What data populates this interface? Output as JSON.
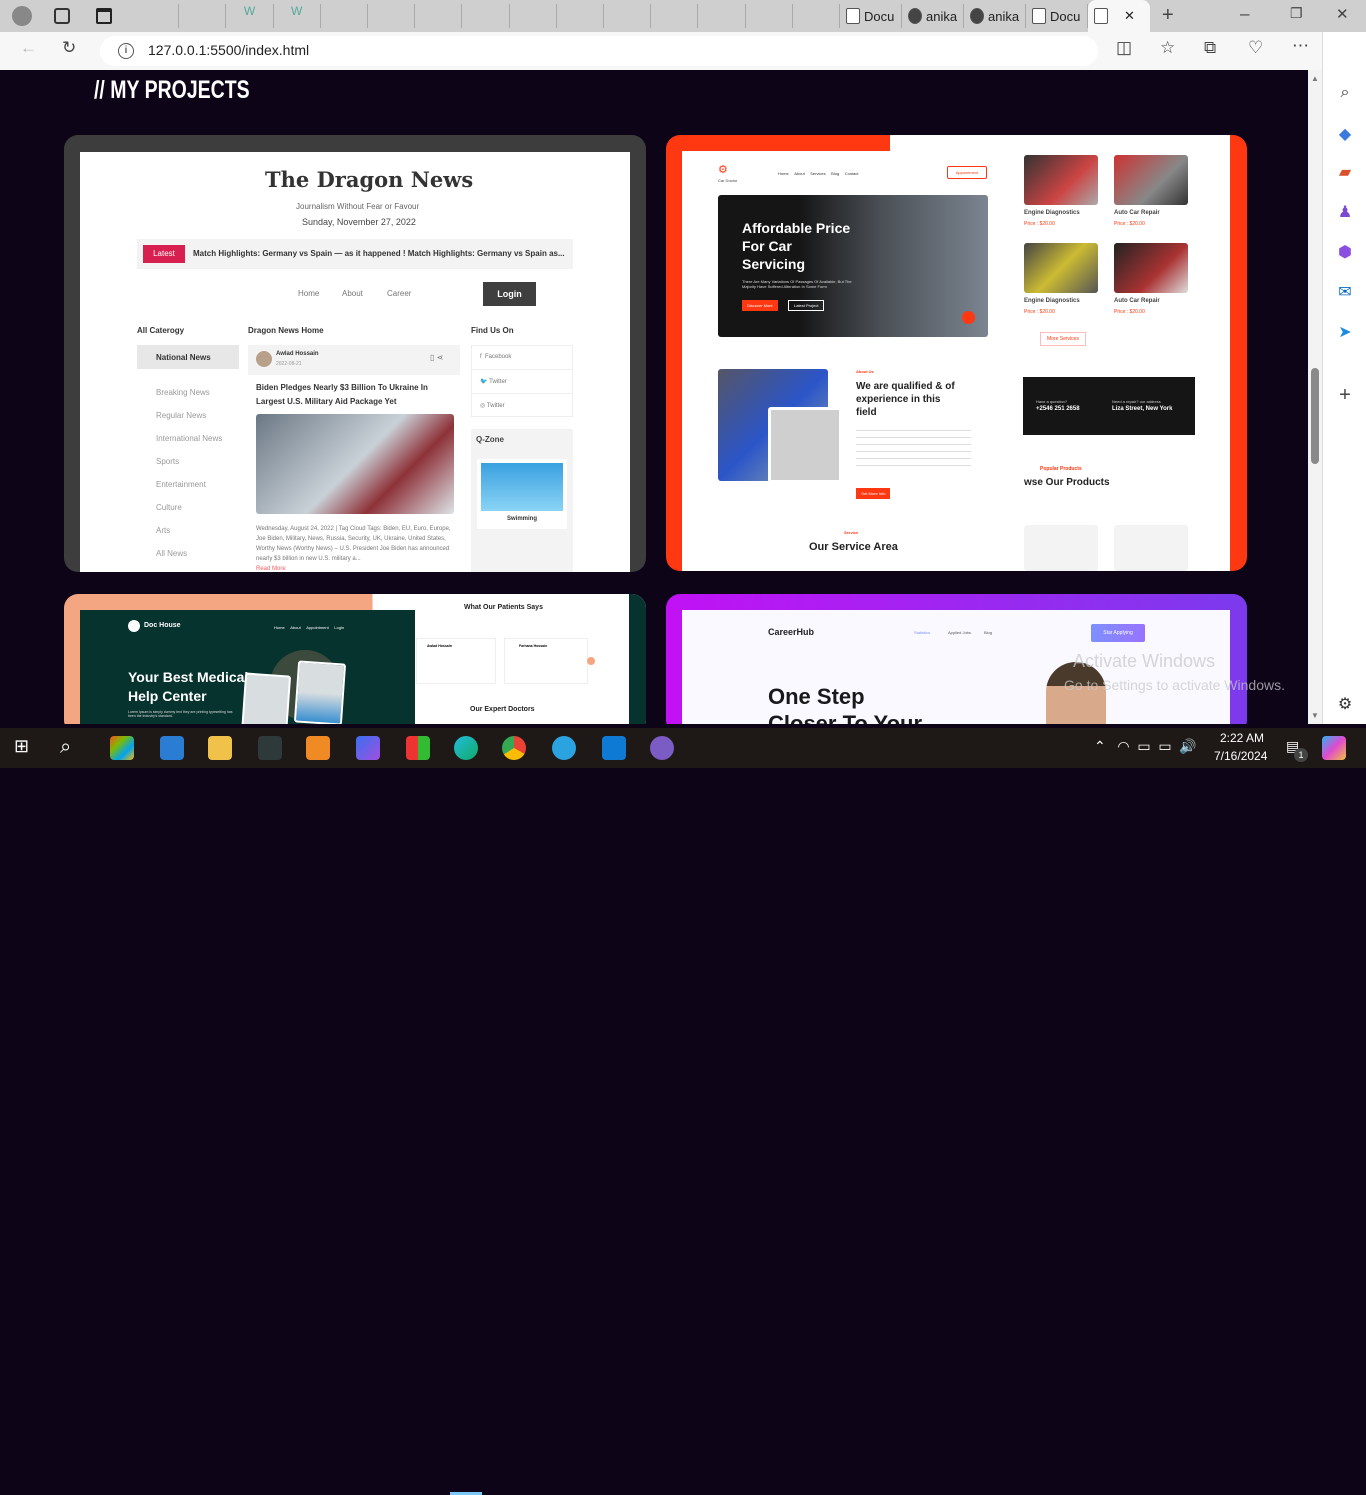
{
  "browser": {
    "tabs": [
      "Docu",
      "anika",
      "anika",
      "Docu",
      ""
    ],
    "url": "127.0.0.1:5500/index.html"
  },
  "page": {
    "title": "// MY PROJECTS"
  },
  "dragon": {
    "logo": "The Dragon News",
    "tagline": "Journalism Without Fear or Favour",
    "date": "Sunday, November 27, 2022",
    "latest": "Latest",
    "ticker": "Match Highlights: Germany vs Spain — as it happened  !  Match Highlights: Germany vs Spain as...",
    "nav": [
      "Home",
      "About",
      "Career"
    ],
    "login": "Login",
    "cat_title": "All Caterogy",
    "categories": [
      "National News",
      "Breaking News",
      "Regular News",
      "International News",
      "Sports",
      "Entertainment",
      "Culture",
      "Arts",
      "All News"
    ],
    "home_title": "Dragon News Home",
    "author": "Awlad Hossain",
    "post_date": "2022-08-21",
    "headline": "Biden Pledges Nearly $3 Billion To Ukraine In Largest U.S. Military Aid Package Yet",
    "body": "Wednesday, August 24, 2022 | Tag Cloud Tags: Biden, EU, Euro, Europe, Joe Biden, Military, News, Russia, Security, UK, Ukraine, United States, Worthy News (Worthy News) – U.S. President Joe Biden has announced nearly $3 billion in new U.S. military a...",
    "read_more": "Read More",
    "find": "Find Us On",
    "social": [
      "Facebook",
      "Twitter",
      "Twitter"
    ],
    "qzone": "Q-Zone",
    "swimming": "Swimming"
  },
  "car": {
    "brand": "Car Doctor",
    "nav": [
      "Home",
      "About",
      "Services",
      "Blog",
      "Contact"
    ],
    "appointment": "Appointment",
    "hero": "Affordable Price For Car Servicing",
    "hero_sub": "There Are Many Variations Of Passages Of Available, But The Majority Have Suffered Alteration In Some Form",
    "discover": "Discover More",
    "latest": "Latest Project",
    "about_label": "About Us",
    "about_title": "We are qualified & of experience in this field",
    "more_info": "Get More Info",
    "service_label": "Service",
    "service_title": "Our Service Area",
    "services": [
      {
        "name": "Engine Diagnostics",
        "price": "Price : $20.00"
      },
      {
        "name": "Auto Car Repair",
        "price": "Price : $20.00"
      },
      {
        "name": "Engine Diagnostics",
        "price": "Price : $20.00"
      },
      {
        "name": "Auto Car Repair",
        "price": "Price : $20.00"
      }
    ],
    "more_services": "More Services",
    "question": "Have a question?",
    "phone": "+2546 251 2658",
    "repair": "Need a repair? our address",
    "address": "Liza Street, New York",
    "popular": "Popular Products",
    "products": "wse Our Products"
  },
  "doc": {
    "brand": "Doc House",
    "nav": [
      "Home",
      "About",
      "Appointment",
      "Login"
    ],
    "hero": "Your Best Medical Help Center",
    "sub": "Lorem Ipsum is simply dummy text they are printing typesetting has been the industry's standard.",
    "patients": "What Our Patients Says",
    "reviewers": [
      "Awlad Hossain",
      "Farhana Hossain"
    ],
    "doctors": "Our Expert Doctors"
  },
  "career": {
    "brand": "CareerHub",
    "nav": [
      "Statistics",
      "Applied Jobs",
      "Blog"
    ],
    "cta": "Star Applying",
    "hero": "One Step",
    "hero2": "Closer To Your"
  },
  "watermark": {
    "title": "Activate Windows",
    "sub": "Go to Settings to activate Windows."
  },
  "taskbar": {
    "time": "2:22 AM",
    "date": "7/16/2024",
    "notif": "1"
  },
  "colors": {
    "bg": "#0d0418",
    "orange": "#ff3811",
    "dragon_red": "#d72050",
    "doc_green": "#07332f",
    "purple": "#7c3aed"
  }
}
